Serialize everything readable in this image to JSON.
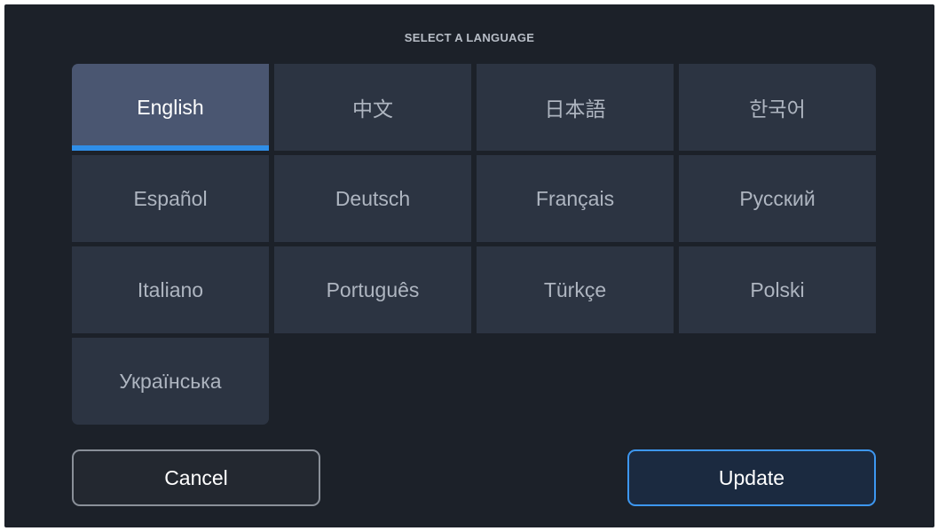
{
  "dialog": {
    "title": "SELECT A LANGUAGE"
  },
  "languages": [
    {
      "label": "English",
      "selected": true
    },
    {
      "label": "中文",
      "selected": false
    },
    {
      "label": "日本語",
      "selected": false
    },
    {
      "label": "한국어",
      "selected": false
    },
    {
      "label": "Español",
      "selected": false
    },
    {
      "label": "Deutsch",
      "selected": false
    },
    {
      "label": "Français",
      "selected": false
    },
    {
      "label": "Русский",
      "selected": false
    },
    {
      "label": "Italiano",
      "selected": false
    },
    {
      "label": "Português",
      "selected": false
    },
    {
      "label": "Türkçe",
      "selected": false
    },
    {
      "label": "Polski",
      "selected": false
    },
    {
      "label": "Українська",
      "selected": false
    }
  ],
  "buttons": {
    "cancel_label": "Cancel",
    "update_label": "Update"
  },
  "colors": {
    "background": "#1c2129",
    "tile": "#2c3442",
    "tile_selected": "#4a5671",
    "selected_indicator": "#2f8ee8",
    "update_border": "#3d97f0"
  }
}
